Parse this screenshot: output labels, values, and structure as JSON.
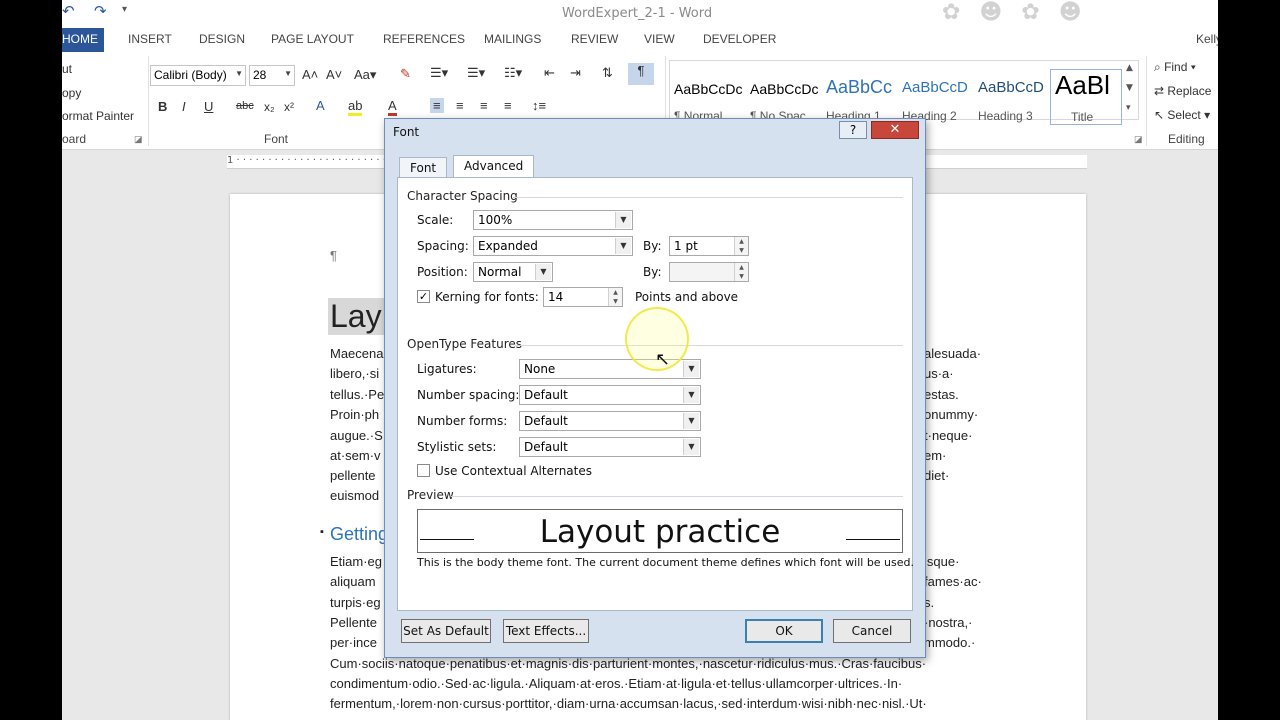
{
  "window": {
    "title": "WordExpert_2-1 - Word",
    "user": "Kelly"
  },
  "tabs": [
    "HOME",
    "INSERT",
    "DESIGN",
    "PAGE LAYOUT",
    "REFERENCES",
    "MAILINGS",
    "REVIEW",
    "VIEW",
    "DEVELOPER"
  ],
  "ribbon": {
    "clipboard": {
      "cut": "ut",
      "copy": "opy",
      "format_painter": "ormat Painter",
      "group": "oard"
    },
    "font": {
      "name": "Calibri (Body)",
      "size": "28",
      "group": "Font"
    },
    "styles": [
      {
        "preview": "AaBbCcDc",
        "name": "¶ Normal"
      },
      {
        "preview": "AaBbCcDc",
        "name": "¶ No Spac..."
      },
      {
        "preview": "AaBbCc",
        "name": "Heading 1"
      },
      {
        "preview": "AaBbCcD",
        "name": "Heading 2"
      },
      {
        "preview": "AaBbCcD",
        "name": "Heading 3"
      },
      {
        "preview": "AaBl",
        "name": "Title"
      }
    ],
    "editing": {
      "find": "Find",
      "replace": "Replace",
      "select": "Select",
      "group": "Editing"
    }
  },
  "document": {
    "pilcrow": "¶",
    "title_partial": "Lay",
    "heading_partial": "Getting",
    "left_lines": [
      "Maecena",
      "libero,·si",
      "tellus.·Pe",
      "Proin·ph",
      "augue.·S",
      "at·sem·v",
      "pellente",
      "euismod"
    ],
    "right_lines": [
      "alesuada·",
      "us·a·",
      "estas.",
      "onummy·",
      "t·neque·",
      "em·",
      "diet·",
      ""
    ],
    "left_lines2": [
      "Etiam·eg",
      "aliquam",
      "turpis·eg",
      "Pellente",
      "per·ince"
    ],
    "right_lines2": [
      "isque·",
      "fames·ac·",
      "s.",
      "·nostra,·",
      "mmodo.·"
    ],
    "full_lines": [
      "Cum·sociis·natoque·penatibus·et·magnis·dis·parturient·montes,·nascetur·ridiculus·mus.·Cras·faucibus·",
      "condimentum·odio.·Sed·ac·ligula.·Aliquam·at·eros.·Etiam·at·ligula·et·tellus·ullamcorper·ultrices.·In·",
      "fermentum,·lorem·non·cursus·porttitor,·diam·urna·accumsan·lacus,·sed·interdum·wisi·nibh·nec·nisl.·Ut·"
    ]
  },
  "dialog": {
    "title": "Font",
    "help": "?",
    "close": "✕",
    "tabs": [
      "Font",
      "Advanced"
    ],
    "character_spacing": {
      "section": "Character Spacing",
      "scale_label": "Scale:",
      "scale_value": "100%",
      "spacing_label": "Spacing:",
      "spacing_value": "Expanded",
      "spacing_by_label": "By:",
      "spacing_by_value": "1 pt",
      "position_label": "Position:",
      "position_value": "Normal",
      "position_by_label": "By:",
      "position_by_value": "",
      "kerning_label": "Kerning for fonts:",
      "kerning_checked": true,
      "kerning_value": "14",
      "kerning_suffix": "Points and above"
    },
    "opentype": {
      "section": "OpenType Features",
      "ligatures_label": "Ligatures:",
      "ligatures_value": "None",
      "number_spacing_label": "Number spacing:",
      "number_spacing_value": "Default",
      "number_forms_label": "Number forms:",
      "number_forms_value": "Default",
      "stylistic_sets_label": "Stylistic sets:",
      "stylistic_sets_value": "Default",
      "contextual_label": "Use Contextual Alternates",
      "contextual_checked": false
    },
    "preview": {
      "section": "Preview",
      "sample": "Layout practice",
      "note": "This is the body theme font. The current document theme defines which font will be used."
    },
    "buttons": {
      "set_default": "Set As Default",
      "text_effects": "Text Effects...",
      "ok": "OK",
      "cancel": "Cancel"
    }
  }
}
